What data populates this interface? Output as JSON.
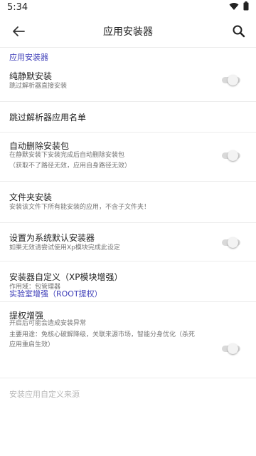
{
  "status_bar": {
    "time": "5:34"
  },
  "app_bar": {
    "title": "应用安装器"
  },
  "sections": [
    {
      "header": "应用安装器",
      "items": [
        {
          "title": "纯静默安装",
          "summary": "跳过解析器直接安装",
          "toggle": false
        },
        {
          "title": "跳过解析器应用名单"
        },
        {
          "title": "自动删除安装包",
          "summary": "在静默安装下安装完成后自动删除安装包",
          "summary2": "（获取不了路径无效，应用自身路径无效）",
          "toggle": false
        },
        {
          "title": "文件夹安装",
          "summary": "安装该文件下所有能安装的应用，不含子文件夹！"
        },
        {
          "title": "设置为系统默认安装器",
          "summary": "如果无效请尝试使用Xp模块完成此设定",
          "toggle": false
        },
        {
          "title": "安装器自定义（XP模块增强）",
          "summary": "作用域：包管理器"
        }
      ]
    },
    {
      "header": "实验室增强（ROOT提权）",
      "items": [
        {
          "title": "提权增强",
          "summary": "开启后可能会造成安装异常",
          "summary2": "主要用途：免核心破解降级，关联来源市场，智能分身优化（杀死",
          "summary3": "应用重启生效）",
          "toggle": false
        }
      ]
    }
  ],
  "footer_item": {
    "title": "安装应用自定义来源",
    "enabled": false
  }
}
